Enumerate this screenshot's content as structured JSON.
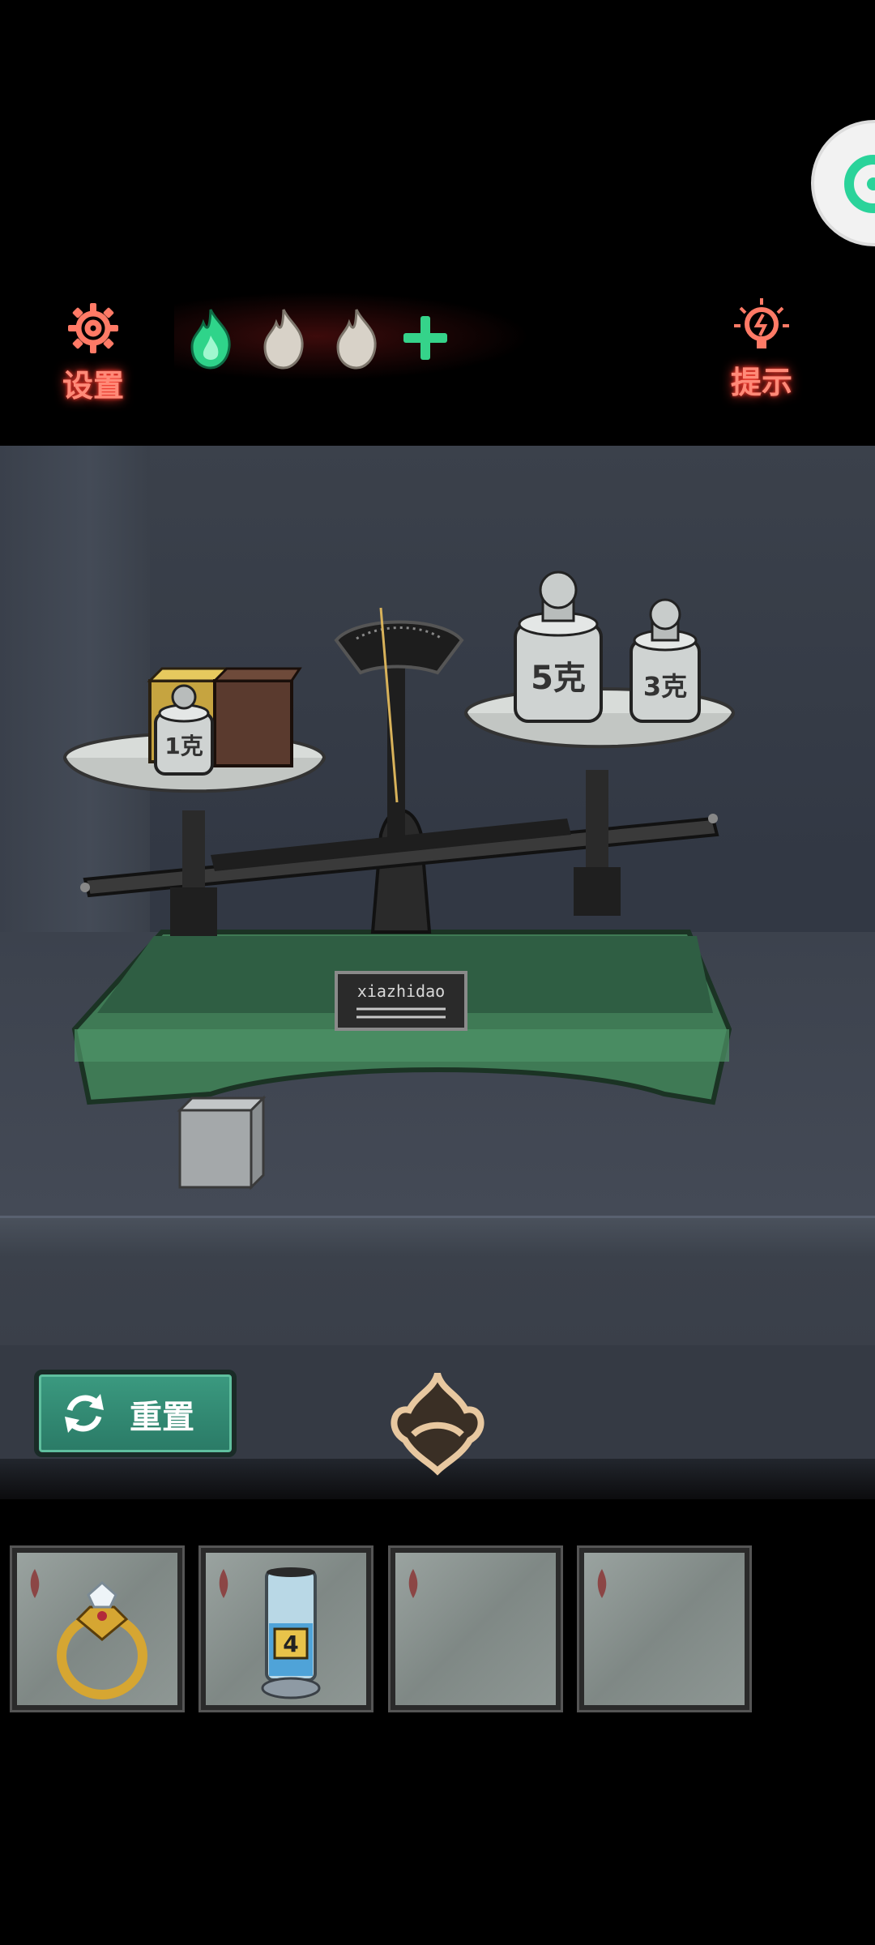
{
  "header": {
    "settings_label": "设置",
    "hint_label": "提示",
    "lives": {
      "filled": 1,
      "empty": 2,
      "add_icon": "plus-icon"
    }
  },
  "scale": {
    "left_weight_label": "1克",
    "right_weight_big_label": "5克",
    "right_weight_small_label": "3克",
    "brand_plate": "xiazhidao"
  },
  "controls": {
    "reset_label": "重置"
  },
  "inventory": {
    "slots": [
      {
        "item": "ring-icon"
      },
      {
        "item": "tube-icon",
        "item_label": "4"
      },
      {
        "item": ""
      },
      {
        "item": ""
      }
    ]
  },
  "colors": {
    "accent_red": "#ff8a78",
    "life_green": "#35d38a",
    "reset_green": "#2f8a72"
  }
}
